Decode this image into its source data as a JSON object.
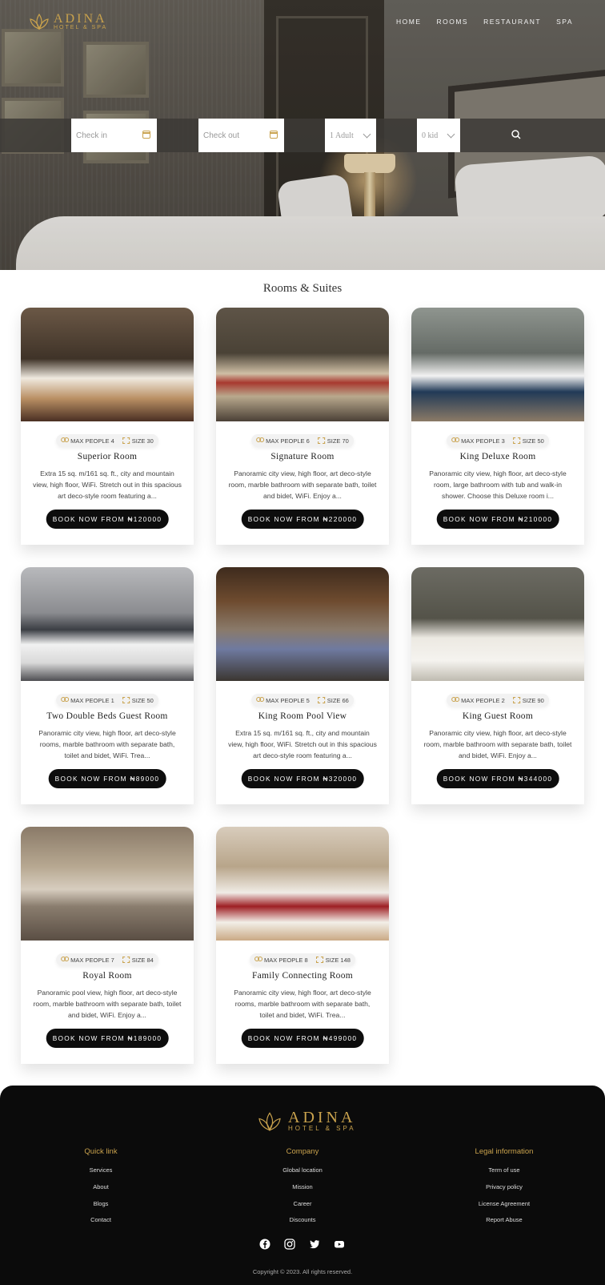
{
  "brand": {
    "name": "ADINA",
    "tagline": "HOTEL & SPA",
    "accent": "#c9a24d"
  },
  "nav": {
    "items": [
      {
        "label": "HOME"
      },
      {
        "label": "ROOMS"
      },
      {
        "label": "RESTAURANT"
      },
      {
        "label": "SPA"
      }
    ]
  },
  "search": {
    "checkin_placeholder": "Check in",
    "checkout_placeholder": "Check out",
    "adults": "1 Adult",
    "kids": "0 kid"
  },
  "rooms_section": {
    "title": "Rooms & Suites"
  },
  "rooms": [
    {
      "max_people": "MAX PEOPLE 4",
      "size": "SIZE 30",
      "title": "Superior Room",
      "desc": "Extra 15 sq. m/161 sq. ft., city and mountain view, high floor, WiFi. Stretch out in this spacious art deco-style room featuring a...",
      "book": "BOOK NOW FROM ₦120000"
    },
    {
      "max_people": "MAX PEOPLE 6",
      "size": "SIZE 70",
      "title": "Signature Room",
      "desc": "Panoramic city view, high floor, art deco-style room, marble bathroom with separate bath, toilet and bidet, WiFi. Enjoy a...",
      "book": "BOOK NOW FROM ₦220000"
    },
    {
      "max_people": "MAX PEOPLE 3",
      "size": "SIZE 50",
      "title": "King Deluxe Room",
      "desc": "Panoramic city view, high floor, art deco-style room, large bathroom with tub and walk-in shower. Choose this Deluxe room i...",
      "book": "BOOK NOW FROM ₦210000"
    },
    {
      "max_people": "MAX PEOPLE 1",
      "size": "SIZE 50",
      "title": "Two Double Beds Guest Room",
      "desc": "Panoramic city view, high floor, art deco-style rooms, marble bathroom with separate bath, toilet and bidet, WiFi. Trea...",
      "book": "BOOK NOW FROM ₦89000"
    },
    {
      "max_people": "MAX PEOPLE 5",
      "size": "SIZE 66",
      "title": "King Room Pool View",
      "desc": "Extra 15 sq. m/161 sq. ft., city and mountain view, high floor, WiFi. Stretch out in this spacious art deco-style room featuring a...",
      "book": "BOOK NOW FROM ₦320000"
    },
    {
      "max_people": "MAX PEOPLE 2",
      "size": "SIZE 90",
      "title": "King Guest Room",
      "desc": "Panoramic city view, high floor, art deco-style room, marble bathroom with separate bath, toilet and bidet, WiFi. Enjoy a...",
      "book": "BOOK NOW FROM ₦344000"
    },
    {
      "max_people": "MAX PEOPLE 7",
      "size": "SIZE 84",
      "title": "Royal Room",
      "desc": "Panoramic pool view, high floor, art deco-style room, marble bathroom with separate bath, toilet and bidet, WiFi. Enjoy a...",
      "book": "BOOK NOW FROM ₦189000"
    },
    {
      "max_people": "MAX PEOPLE 8",
      "size": "SIZE 148",
      "title": "Family Connecting Room",
      "desc": "Panoramic city view, high floor, art deco-style rooms, marble bathroom with separate bath, toilet and bidet, WiFi. Trea...",
      "book": "BOOK NOW FROM ₦499000"
    }
  ],
  "footer": {
    "quick_link": {
      "title": "Quick link",
      "items": [
        "Services",
        "About",
        "Blogs",
        "Contact"
      ]
    },
    "company": {
      "title": "Company",
      "items": [
        "Global location",
        "Mission",
        "Career",
        "Discounts"
      ]
    },
    "legal": {
      "title": "Legal information",
      "items": [
        "Term of use",
        "Privacy policy",
        "License Agreement",
        "Report Abuse"
      ]
    },
    "social": [
      "facebook-icon",
      "instagram-icon",
      "twitter-icon",
      "youtube-icon"
    ],
    "copyright": "Copyright © 2023. All rights reserved."
  }
}
